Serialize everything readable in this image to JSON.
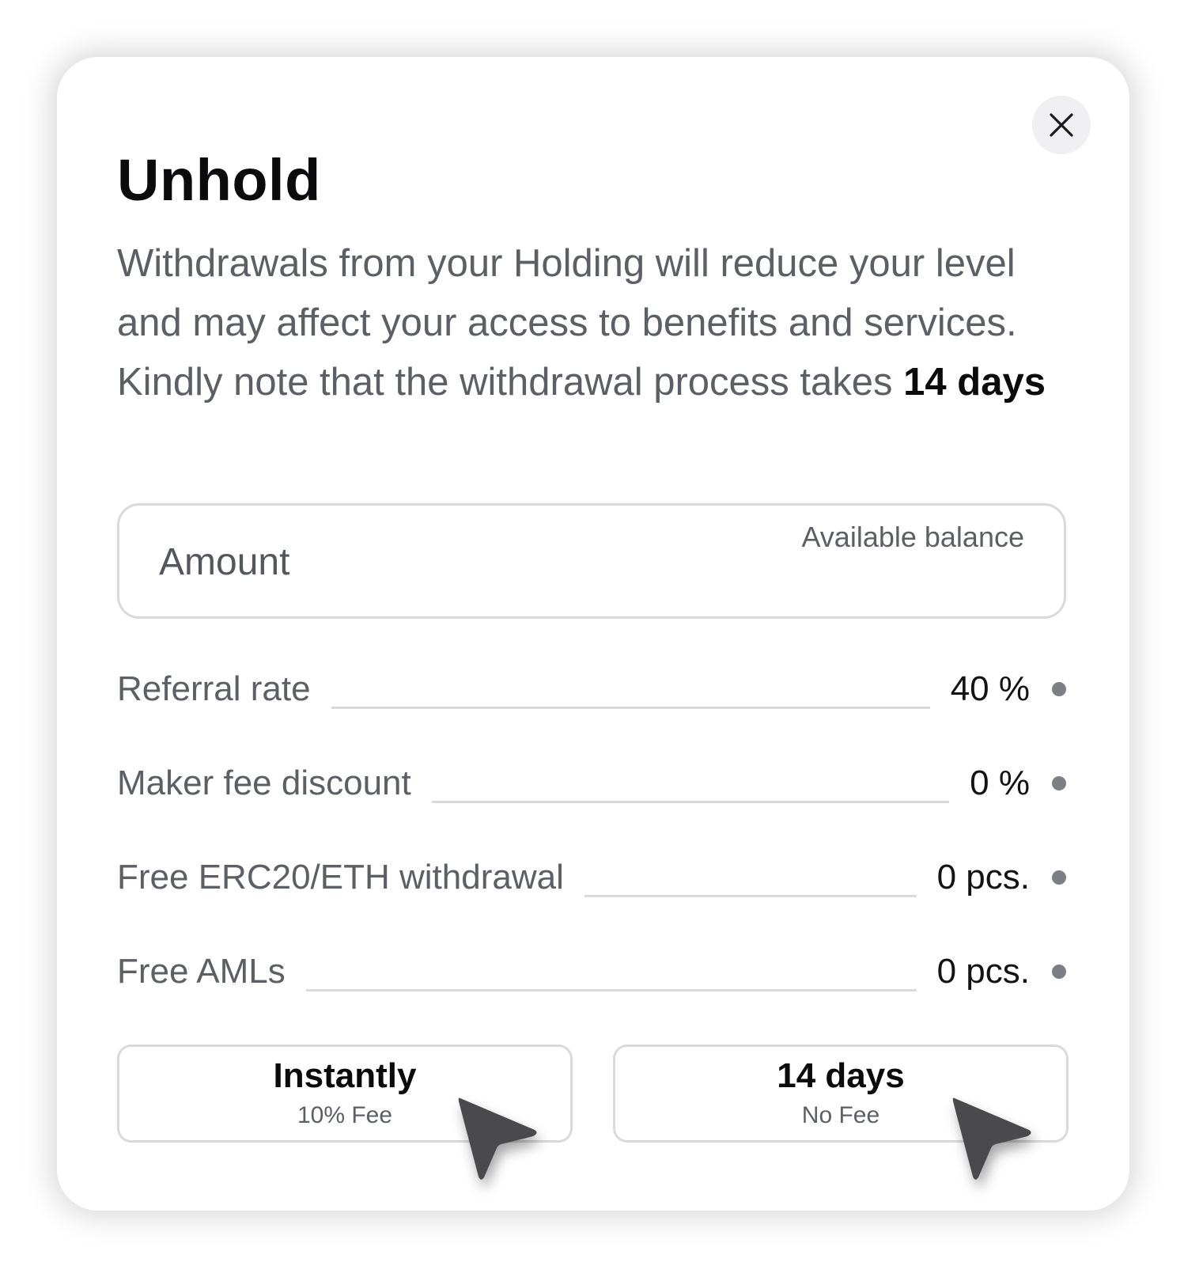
{
  "dialog": {
    "title": "Unhold",
    "description_prefix": "Withdrawals from your Holding will reduce your level and may affect your access to benefits and services. Kindly note that the withdrawal process takes ",
    "description_emphasis": "14 days",
    "close_icon": "close-icon"
  },
  "amount_field": {
    "placeholder": "Amount",
    "value": "",
    "balance_label": "Available balance"
  },
  "benefits": [
    {
      "label": "Referral rate",
      "value": "40 %"
    },
    {
      "label": "Maker fee discount",
      "value": "0 %"
    },
    {
      "label": "Free ERC20/ETH withdrawal",
      "value": "0 pcs."
    },
    {
      "label": "Free AMLs",
      "value": "0 pcs."
    }
  ],
  "options": [
    {
      "title": "Instantly",
      "subtitle": "10% Fee"
    },
    {
      "title": "14 days",
      "subtitle": "No Fee"
    }
  ],
  "colors": {
    "text_primary": "#0b0b0d",
    "text_secondary": "#5d5f66",
    "border": "#d9dade",
    "dot": "#7d7f86",
    "close_bg": "#f0f0f2",
    "cursor": "#4a4a4c"
  },
  "icons": {
    "close": "close-icon",
    "cursor": "pointer-cursor-icon",
    "dot": "status-dot-icon"
  }
}
